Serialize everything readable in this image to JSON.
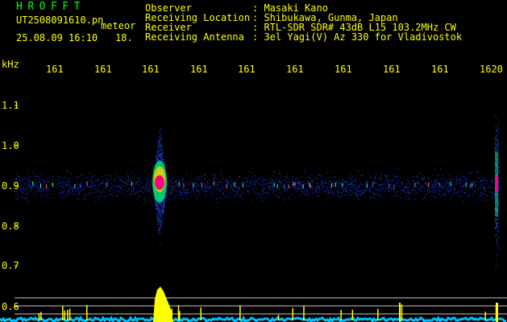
{
  "header": {
    "app_title": "HROFFT",
    "file_name": "UT2508091610.pn",
    "label_meteor": "meteor",
    "datetime": "25.08.09 16:10",
    "count": "18."
  },
  "meta": [
    {
      "label": "Observer",
      "value": ": Masaki Kano"
    },
    {
      "label": "Receiving Location",
      "value": ": Shibukawa, Gunma, Japan"
    },
    {
      "label": "Receiver",
      "value": ": RTL-SDR SDR# 43dB L15 103.2MHz CW"
    },
    {
      "label": "Receiving Antenna",
      "value": ": 3el Yagi(V) Az 330 for Vladivostok"
    }
  ],
  "axis": {
    "y_unit": "kHz",
    "y_ticks": [
      "1.1",
      "1.0",
      "0.9",
      "0.8",
      "0.7",
      "0.6"
    ],
    "x_ticks": [
      "161",
      "161",
      "161",
      "161",
      "161",
      "161",
      "161",
      "161",
      "161",
      "1620"
    ]
  },
  "chart_data": {
    "type": "heatmap",
    "y_unit": "kHz",
    "y_range": [
      0.58,
      1.15
    ],
    "carrier_frequency_khz": 0.9,
    "events": [
      {
        "time_index": 198,
        "freq_center_khz": 0.905,
        "intensity": "strong"
      },
      {
        "time_index": 616,
        "freq_center_khz": 0.905,
        "intensity": "strong"
      }
    ]
  },
  "colors": {
    "text": "#ffff00",
    "title": "#00ff00",
    "signal_low": "#1e3cff",
    "signal_mid": "#00ff66",
    "signal_high": "#ff0080",
    "baseline": "#00c0ff",
    "spike": "#ffff00"
  }
}
